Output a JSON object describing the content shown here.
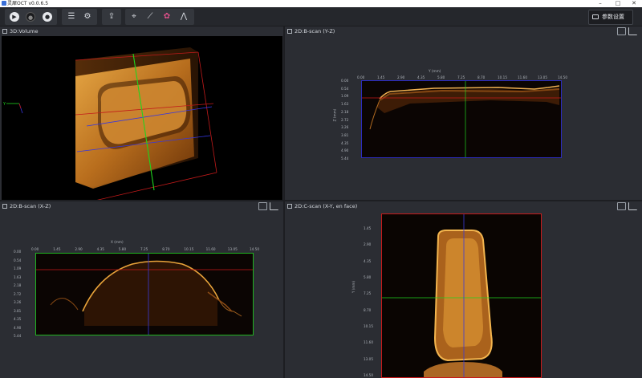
{
  "app": {
    "title": "灵犀OCT v0.0.6.5"
  },
  "toolbar": {
    "settings_label": "参数设置",
    "buttons": [
      "play-icon",
      "stop-icon",
      "record-icon",
      "sliders-icon",
      "gear-icon",
      "export-icon",
      "crosshair-frame-icon",
      "line-chart-icon",
      "color-palette-icon",
      "peak-chart-icon"
    ]
  },
  "panels": {
    "volume": {
      "title": "3D:Volume"
    },
    "yz": {
      "title": "2D:B-scan (Y-Z)",
      "x_axis_label": "Y (mm)",
      "y_axis_label": "Z (mm)",
      "x_ticks": [
        "0.00",
        "1.45",
        "2.90",
        "4.35",
        "5.80",
        "7.25",
        "8.70",
        "10.15",
        "11.60",
        "13.05",
        "14.50"
      ],
      "y_ticks": [
        "0.00",
        "0.54",
        "1.09",
        "1.63",
        "2.18",
        "2.72",
        "3.26",
        "3.81",
        "4.35",
        "4.90",
        "5.44"
      ]
    },
    "xz": {
      "title": "2D:B-scan (X-Z)",
      "x_axis_label": "X (mm)",
      "y_axis_label": "Z (mm)",
      "x_ticks": [
        "0.00",
        "1.45",
        "2.90",
        "4.35",
        "5.80",
        "7.25",
        "8.70",
        "10.15",
        "11.60",
        "13.05",
        "14.50"
      ],
      "y_ticks": [
        "0.00",
        "0.54",
        "1.09",
        "1.63",
        "2.18",
        "2.72",
        "3.26",
        "3.81",
        "4.35",
        "4.90",
        "5.44"
      ]
    },
    "xy": {
      "title": "2D:C-scan (X-Y, en face)",
      "y_axis_label": "Y (mm)",
      "y_ticks": [
        "1.45",
        "2.90",
        "4.35",
        "5.80",
        "7.25",
        "8.70",
        "10.15",
        "11.60",
        "13.05",
        "14.50"
      ]
    }
  },
  "colors": {
    "background": "#2b2d33",
    "toolbar": "#25272c",
    "oct_bright": "#e8a33a",
    "oct_dim": "#5a2a08",
    "crosshair_red": "#d01a1a",
    "crosshair_green": "#1fd41f",
    "crosshair_blue": "#3a3ad8"
  }
}
